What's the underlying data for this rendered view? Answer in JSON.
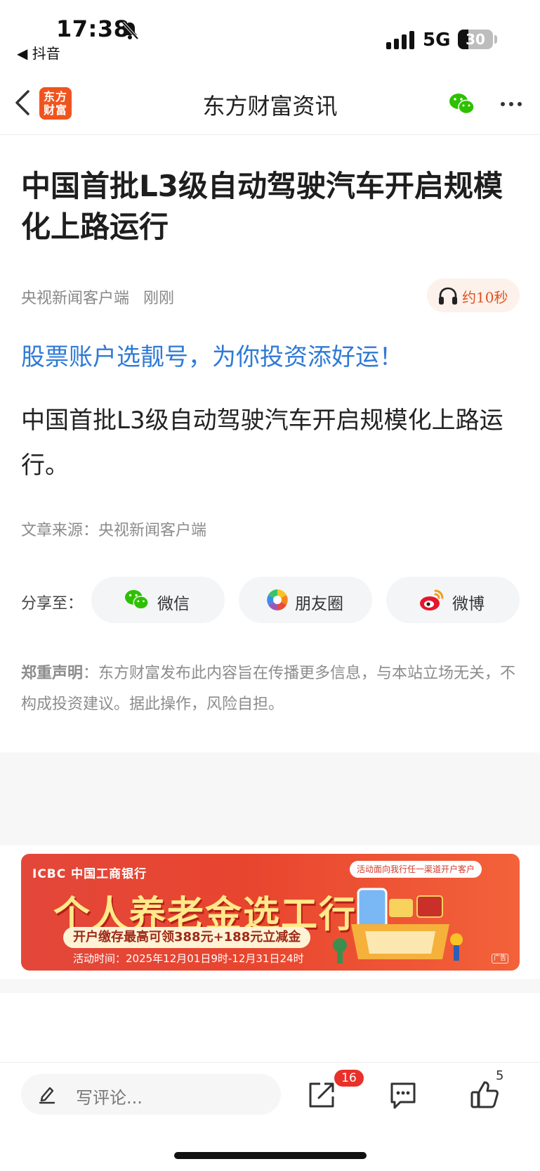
{
  "status_bar": {
    "time": "17:38",
    "back_app": "◀ 抖音",
    "network": "5G",
    "battery": "30",
    "battery_level": 0.3
  },
  "nav": {
    "logo_text_line1": "东方",
    "logo_text_line2": "财富",
    "title": "东方财富资讯"
  },
  "article": {
    "headline": "中国首批L3级自动驾驶汽车开启规模化上路运行",
    "source_name": "央视新闻客户端",
    "time": "刚刚",
    "audio_label": "约10秒",
    "promo_link": "股票账户选靓号，为你投资添好运！",
    "body": "中国首批L3级自动驾驶汽车开启规模化上路运行。",
    "source_line": "文章来源：央视新闻客户端"
  },
  "share": {
    "label": "分享至：",
    "wechat": "微信",
    "moments": "朋友圈",
    "weibo": "微博"
  },
  "disclaimer": {
    "title": "郑重声明",
    "text": "：东方财富发布此内容旨在传播更多信息，与本站立场无关，不构成投资建议。据此操作，风险自担。"
  },
  "ad": {
    "brand": "ICBC  中国工商银行",
    "tag": "活动面向我行任一渠道开户客户",
    "headline": "个人养老金选工行",
    "sub": "开户缴存最高可领388元+188元立减金",
    "time": "活动时间：2025年12月01日9时-12月31日24时",
    "ad_label": "广告"
  },
  "bottom_bar": {
    "comment_placeholder": "写评论...",
    "share_badge": "16",
    "like_count": "5"
  },
  "colors": {
    "accent": "#e0521c",
    "link": "#2f7ad6",
    "badge": "#e8312a",
    "logo": "#f0541e",
    "wechat": "#2dc100"
  }
}
